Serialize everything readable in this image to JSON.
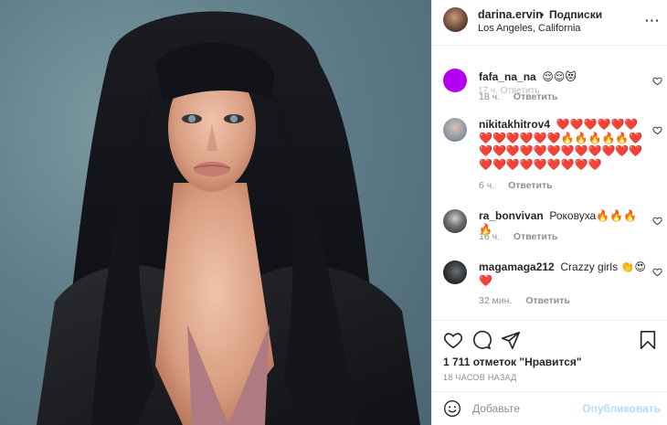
{
  "header": {
    "username": "darina.ervin",
    "dot": "•",
    "follow_label": "Подписки",
    "location": "Los Angeles, California",
    "more_glyph": "⋯",
    "partial_meta": "17 ч.   Ответить"
  },
  "comments": [
    {
      "username": "fafa_na_na",
      "text": "😌😌😻",
      "time": "18 ч.",
      "reply_label": "Ответить",
      "avatar_color": "#b300f0"
    },
    {
      "username": "nikitakhitrov4",
      "text": "❤️❤️❤️❤️❤️❤️❤️❤️❤️❤️❤️❤️🔥🔥🔥🔥🔥❤️❤️❤️❤️❤️❤️❤️❤️❤️❤️❤️❤️❤️❤️❤️❤️❤️❤️❤️❤️❤️❤️",
      "time": "6 ч.",
      "reply_label": "Ответить",
      "avatar_color": "#9aa4ad"
    },
    {
      "username": "ra_bonvivan",
      "text": "Роковуха🔥🔥🔥🔥",
      "time": "16 ч.",
      "reply_label": "Ответить",
      "avatar_color": "#4a4a4a"
    },
    {
      "username": "magamaga212",
      "text": "Crazzy girls 👏😍❤️",
      "time": "32 мин.",
      "reply_label": "Ответить",
      "avatar_color": "#2b2d2f"
    }
  ],
  "actions": {
    "like_icon": "heart-icon",
    "comment_icon": "comment-icon",
    "share_icon": "share-icon",
    "save_icon": "bookmark-icon",
    "likes_text": "1 711 отметок \"Нравится\"",
    "time_ago": "18 ЧАСОВ НАЗАД"
  },
  "composer": {
    "placeholder": "Добавьте",
    "publish_label": "Опубликовать"
  }
}
